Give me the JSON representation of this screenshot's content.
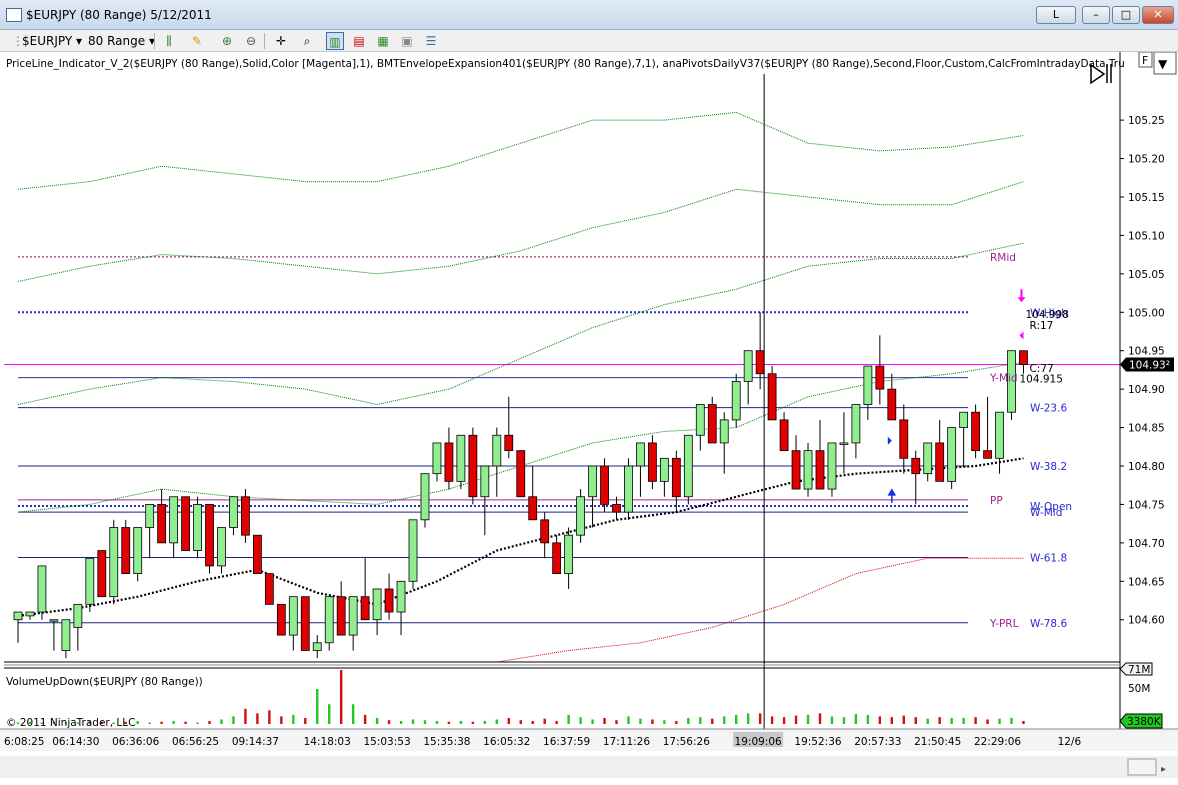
{
  "window": {
    "title": "$EURJPY (80 Range)  5/12/2011",
    "buttons": [
      "L",
      "–",
      "□",
      "✕"
    ]
  },
  "toolbar": {
    "instrument": "$EURJPY",
    "period": "80 Range"
  },
  "indicator_label": "PriceLine_Indicator_V_2($EURJPY (80 Range),Solid,Color [Magenta],1), BMTEnvelopeExpansion401($EURJPY (80 Range),7,1), anaPivotsDailyV37($EURJPY (80 Range),Second,Floor,Custom,CalcFromIntradayData,Tru",
  "panel_buttons": {
    "f_button": "F",
    "dropdown": "▼"
  },
  "volume_label": "VolumeUpDown($EURJPY (80 Range))",
  "copyright": "© 2011 NinjaTrader, LLC",
  "colors": {
    "up_candle": "#90ee90",
    "down_candle": "#e00000",
    "price_line": "#ff00ff",
    "envelope_upper": "#008000",
    "envelope_lower": "#e00000",
    "pivot_labels": "#2a2ad0",
    "floor_labels": "#a0208f"
  },
  "chart_data": {
    "type": "candlestick",
    "y_axis": {
      "ylim": [
        104.545,
        105.31
      ],
      "ticks": [
        105.25,
        105.2,
        105.15,
        105.1,
        105.05,
        105.0,
        104.95,
        104.9,
        104.85,
        104.8,
        104.75,
        104.7,
        104.65,
        104.6
      ],
      "tick_labels": [
        "105.25",
        "105.20",
        "105.15",
        "105.10",
        "105.05",
        "105.00",
        "104.95",
        "104.90",
        "104.85",
        "104.80",
        "104.75",
        "104.70",
        "104.65",
        "104.60"
      ],
      "last_price_label": "104.93²"
    },
    "x_axis": {
      "tick_labels": [
        "6:08:25",
        "06:14:30",
        "06:36:06",
        "06:56:25",
        "09:14:37",
        "14:18:03",
        "15:03:53",
        "15:35:38",
        "16:05:32",
        "16:37:59",
        "17:11:26",
        "17:56:26",
        "19:09:06",
        "19:52:36",
        "20:57:33",
        "21:50:45",
        "22:29:06",
        "12/6"
      ],
      "tick_bar_index": [
        0,
        5,
        10,
        15,
        20,
        26,
        31,
        36,
        41,
        46,
        51,
        56,
        62,
        67,
        72,
        77,
        82,
        88
      ],
      "highlighted_label": "19:09:06"
    },
    "cursor_bar_index": 62,
    "last_price": 104.932,
    "candles": [
      [
        104.6,
        104.6,
        104.57,
        104.61
      ],
      [
        104.605,
        104.61,
        104.6,
        104.61
      ],
      [
        104.61,
        104.67,
        104.6,
        104.67
      ],
      [
        104.6,
        104.6,
        104.56,
        104.6
      ],
      [
        104.56,
        104.6,
        104.55,
        104.6
      ],
      [
        104.59,
        104.62,
        104.56,
        104.62
      ],
      [
        104.62,
        104.68,
        104.61,
        104.68
      ],
      [
        104.69,
        104.69,
        104.63,
        104.63
      ],
      [
        104.63,
        104.73,
        104.62,
        104.72
      ],
      [
        104.72,
        104.73,
        104.66,
        104.66
      ],
      [
        104.66,
        104.72,
        104.65,
        104.72
      ],
      [
        104.72,
        104.75,
        104.68,
        104.75
      ],
      [
        104.75,
        104.77,
        104.7,
        104.7
      ],
      [
        104.7,
        104.76,
        104.68,
        104.76
      ],
      [
        104.76,
        104.76,
        104.69,
        104.69
      ],
      [
        104.69,
        104.76,
        104.68,
        104.75
      ],
      [
        104.75,
        104.75,
        104.66,
        104.67
      ],
      [
        104.67,
        104.72,
        104.66,
        104.72
      ],
      [
        104.72,
        104.76,
        104.71,
        104.76
      ],
      [
        104.76,
        104.77,
        104.7,
        104.71
      ],
      [
        104.71,
        104.71,
        104.66,
        104.66
      ],
      [
        104.66,
        104.66,
        104.62,
        104.62
      ],
      [
        104.62,
        104.62,
        104.58,
        104.58
      ],
      [
        104.58,
        104.63,
        104.56,
        104.63
      ],
      [
        104.63,
        104.63,
        104.56,
        104.56
      ],
      [
        104.56,
        104.58,
        104.55,
        104.57
      ],
      [
        104.57,
        104.63,
        104.56,
        104.63
      ],
      [
        104.63,
        104.65,
        104.58,
        104.58
      ],
      [
        104.58,
        104.63,
        104.56,
        104.63
      ],
      [
        104.63,
        104.68,
        104.6,
        104.6
      ],
      [
        104.6,
        104.64,
        104.58,
        104.64
      ],
      [
        104.64,
        104.66,
        104.6,
        104.61
      ],
      [
        104.61,
        104.65,
        104.58,
        104.65
      ],
      [
        104.65,
        104.73,
        104.64,
        104.73
      ],
      [
        104.73,
        104.79,
        104.72,
        104.79
      ],
      [
        104.79,
        104.83,
        104.78,
        104.83
      ],
      [
        104.83,
        104.85,
        104.77,
        104.78
      ],
      [
        104.78,
        104.84,
        104.77,
        104.84
      ],
      [
        104.84,
        104.85,
        104.75,
        104.76
      ],
      [
        104.76,
        104.8,
        104.71,
        104.8
      ],
      [
        104.8,
        104.85,
        104.76,
        104.84
      ],
      [
        104.84,
        104.89,
        104.81,
        104.82
      ],
      [
        104.82,
        104.82,
        104.76,
        104.76
      ],
      [
        104.76,
        104.8,
        104.73,
        104.73
      ],
      [
        104.73,
        104.74,
        104.68,
        104.7
      ],
      [
        104.7,
        104.71,
        104.66,
        104.66
      ],
      [
        104.66,
        104.72,
        104.64,
        104.71
      ],
      [
        104.71,
        104.77,
        104.7,
        104.76
      ],
      [
        104.76,
        104.8,
        104.72,
        104.8
      ],
      [
        104.8,
        104.81,
        104.74,
        104.75
      ],
      [
        104.75,
        104.76,
        104.73,
        104.74
      ],
      [
        104.74,
        104.81,
        104.73,
        104.8
      ],
      [
        104.8,
        104.83,
        104.76,
        104.83
      ],
      [
        104.83,
        104.84,
        104.77,
        104.78
      ],
      [
        104.78,
        104.81,
        104.76,
        104.81
      ],
      [
        104.81,
        104.82,
        104.74,
        104.76
      ],
      [
        104.76,
        104.84,
        104.75,
        104.84
      ],
      [
        104.84,
        104.88,
        104.82,
        104.88
      ],
      [
        104.88,
        104.89,
        104.83,
        104.83
      ],
      [
        104.83,
        104.87,
        104.79,
        104.86
      ],
      [
        104.86,
        104.92,
        104.85,
        104.91
      ],
      [
        104.91,
        104.95,
        104.88,
        104.95
      ],
      [
        104.95,
        105.0,
        104.9,
        104.92
      ],
      [
        104.92,
        104.93,
        104.86,
        104.86
      ],
      [
        104.86,
        104.87,
        104.82,
        104.82
      ],
      [
        104.82,
        104.84,
        104.77,
        104.77
      ],
      [
        104.77,
        104.83,
        104.76,
        104.82
      ],
      [
        104.82,
        104.86,
        104.77,
        104.77
      ],
      [
        104.77,
        104.83,
        104.76,
        104.83
      ],
      [
        104.83,
        104.87,
        104.79,
        104.83
      ],
      [
        104.83,
        104.88,
        104.81,
        104.88
      ],
      [
        104.88,
        104.93,
        104.86,
        104.93
      ],
      [
        104.93,
        104.97,
        104.88,
        104.9
      ],
      [
        104.9,
        104.92,
        104.86,
        104.86
      ],
      [
        104.86,
        104.88,
        104.79,
        104.81
      ],
      [
        104.81,
        104.82,
        104.75,
        104.79
      ],
      [
        104.79,
        104.83,
        104.78,
        104.83
      ],
      [
        104.83,
        104.86,
        104.78,
        104.78
      ],
      [
        104.78,
        104.85,
        104.77,
        104.85
      ],
      [
        104.85,
        104.87,
        104.8,
        104.87
      ],
      [
        104.87,
        104.88,
        104.81,
        104.82
      ],
      [
        104.82,
        104.89,
        104.81,
        104.81
      ],
      [
        104.81,
        104.87,
        104.79,
        104.87
      ],
      [
        104.87,
        104.95,
        104.86,
        104.95
      ],
      [
        104.95,
        104.95,
        104.92,
        104.932
      ]
    ],
    "lines": {
      "price_line": 104.932,
      "rmid": 105.072,
      "w_high": 105.0,
      "hline_104_915": 104.915,
      "w_23_6": 104.876,
      "w_38_2": 104.8,
      "pp": 104.756,
      "w_open": 104.748,
      "w_mid": 104.74,
      "w_61_8": 104.681,
      "w_78_6": 104.596
    },
    "level_labels": [
      {
        "text": "RMid",
        "value": 105.072,
        "group": "floor"
      },
      {
        "text": "W-High",
        "value": 105.0,
        "group": "pivot"
      },
      {
        "text": "Y-Mid",
        "value": 104.915,
        "group": "floor"
      },
      {
        "text": "W-23.6",
        "value": 104.876,
        "group": "pivot"
      },
      {
        "text": "W-38.2",
        "value": 104.8,
        "group": "pivot"
      },
      {
        "text": "PP",
        "value": 104.756,
        "group": "floor"
      },
      {
        "text": "W-Open",
        "value": 104.748,
        "group": "pivot"
      },
      {
        "text": "W-Mid",
        "value": 104.74,
        "group": "pivot"
      },
      {
        "text": "W-61.8",
        "value": 104.681,
        "group": "pivot"
      },
      {
        "text": "Y-PRL",
        "value": 104.596,
        "group": "floor"
      },
      {
        "text": "W-78.6",
        "value": 104.596,
        "group": "pivot"
      }
    ],
    "envelopes": {
      "upper_outer": {
        "x": [
          0,
          6,
          12,
          18,
          24,
          30,
          36,
          42,
          48,
          54,
          60,
          66,
          72,
          78,
          84
        ],
        "y": [
          105.16,
          105.17,
          105.19,
          105.18,
          105.17,
          105.17,
          105.19,
          105.22,
          105.25,
          105.25,
          105.26,
          105.22,
          105.21,
          105.215,
          105.23
        ]
      },
      "upper_mid": {
        "x": [
          0,
          6,
          12,
          18,
          24,
          30,
          36,
          42,
          48,
          54,
          60,
          66,
          72,
          78,
          84
        ],
        "y": [
          105.04,
          105.06,
          105.075,
          105.07,
          105.06,
          105.05,
          105.06,
          105.08,
          105.11,
          105.13,
          105.16,
          105.15,
          105.14,
          105.14,
          105.17
        ]
      },
      "upper_inner": {
        "x": [
          0,
          6,
          12,
          18,
          24,
          30,
          36,
          42,
          48,
          54,
          60,
          66,
          72,
          78,
          84
        ],
        "y": [
          104.88,
          104.9,
          104.915,
          104.91,
          104.9,
          104.88,
          104.9,
          104.94,
          104.98,
          105.01,
          105.03,
          105.06,
          105.07,
          105.07,
          105.09
        ]
      },
      "lower_inner": {
        "x": [
          0,
          6,
          12,
          18,
          24,
          30,
          36,
          42,
          48,
          54,
          60,
          66,
          72,
          78,
          84
        ],
        "y": [
          104.74,
          104.75,
          104.77,
          104.76,
          104.755,
          104.75,
          104.77,
          104.8,
          104.83,
          104.845,
          104.85,
          104.89,
          104.91,
          104.92,
          104.935
        ]
      },
      "lower_red": {
        "x": [
          40,
          46,
          52,
          58,
          64,
          70,
          76,
          84
        ],
        "y": [
          104.545,
          104.56,
          104.57,
          104.59,
          104.62,
          104.66,
          104.68,
          104.68
        ]
      }
    },
    "moving_average": {
      "x": [
        0,
        5,
        10,
        15,
        20,
        25,
        30,
        35,
        40,
        45,
        50,
        55,
        60,
        65,
        70,
        75,
        80,
        84
      ],
      "y": [
        104.605,
        104.615,
        104.63,
        104.65,
        104.665,
        104.635,
        104.62,
        104.65,
        104.69,
        104.71,
        104.73,
        104.74,
        104.76,
        104.78,
        104.79,
        104.795,
        104.8,
        104.81
      ]
    },
    "annotations": {
      "last_high_label": "104.998",
      "range_label": "R:17",
      "count_label": "C:77",
      "last_low_label": "104.915"
    },
    "volume": {
      "axis_labels": [
        "71M",
        "50M"
      ],
      "current_label": "3380K",
      "ymax": 71,
      "values": [
        2,
        3,
        2,
        3,
        2,
        2,
        4,
        3,
        2,
        3,
        4,
        2,
        3,
        4,
        3,
        2,
        4,
        6,
        10,
        20,
        14,
        18,
        10,
        12,
        8,
        46,
        26,
        71,
        26,
        12,
        8,
        5,
        4,
        6,
        5,
        4,
        3,
        4,
        3,
        4,
        6,
        8,
        5,
        4,
        7,
        4,
        12,
        9,
        6,
        8,
        5,
        10,
        7,
        6,
        5,
        4,
        8,
        9,
        7,
        10,
        12,
        14,
        14,
        10,
        9,
        11,
        12,
        14,
        10,
        9,
        13,
        12,
        10,
        9,
        11,
        9,
        7,
        9,
        8,
        8,
        9,
        6,
        7,
        8,
        4
      ]
    }
  }
}
